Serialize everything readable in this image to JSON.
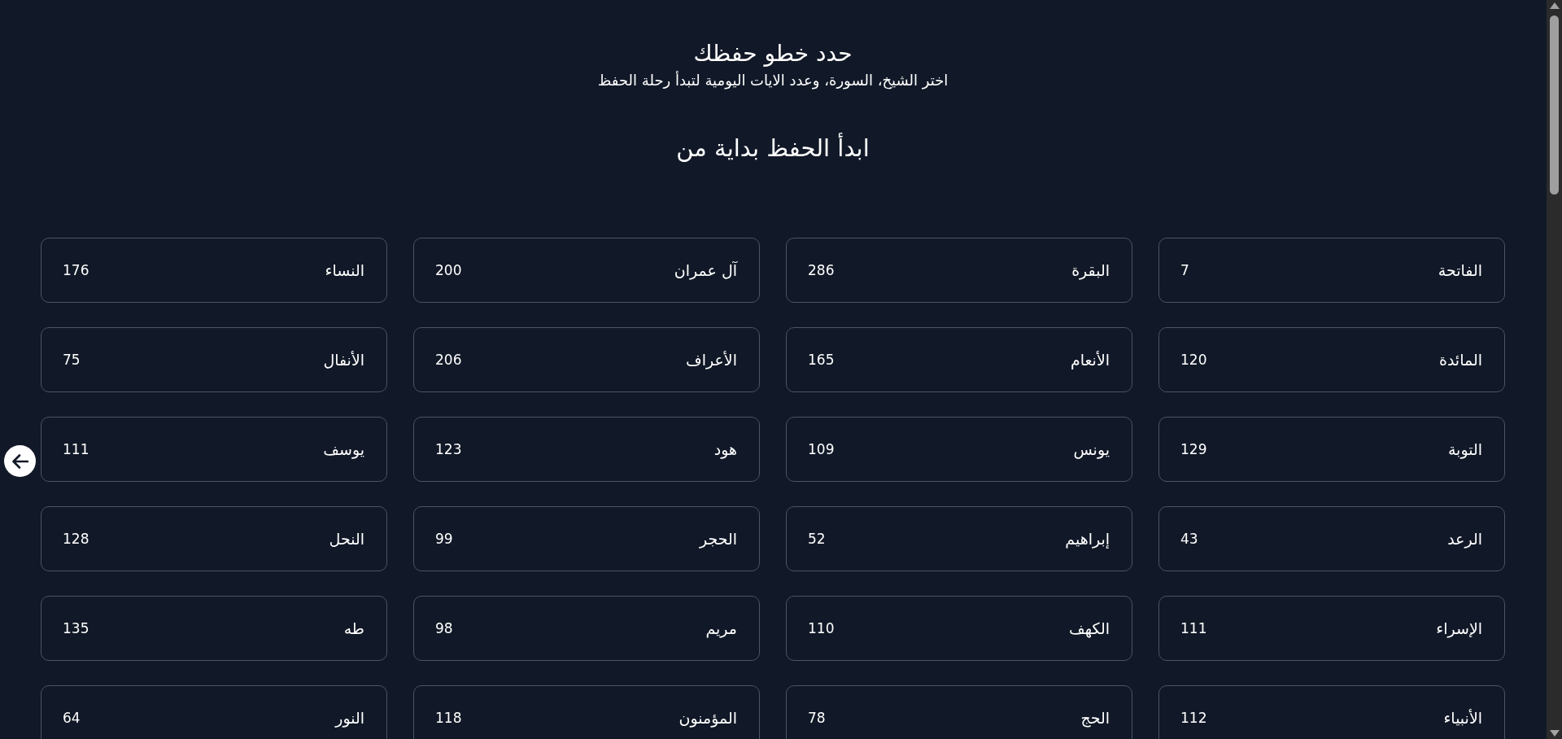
{
  "header": {
    "title": "حدد خطو حفظك",
    "subtitle": "اختر الشيخ، السورة، وعدد الايات اليومية لتبدأ رحلة الحفظ"
  },
  "section": {
    "heading": "ابدأ الحفظ بداية من"
  },
  "surahs": [
    {
      "name": "الفاتحة",
      "verses": "7"
    },
    {
      "name": "البقرة",
      "verses": "286"
    },
    {
      "name": "آل عمران",
      "verses": "200"
    },
    {
      "name": "النساء",
      "verses": "176"
    },
    {
      "name": "المائدة",
      "verses": "120"
    },
    {
      "name": "الأنعام",
      "verses": "165"
    },
    {
      "name": "الأعراف",
      "verses": "206"
    },
    {
      "name": "الأنفال",
      "verses": "75"
    },
    {
      "name": "التوبة",
      "verses": "129"
    },
    {
      "name": "يونس",
      "verses": "109"
    },
    {
      "name": "هود",
      "verses": "123"
    },
    {
      "name": "يوسف",
      "verses": "111"
    },
    {
      "name": "الرعد",
      "verses": "43"
    },
    {
      "name": "إبراهيم",
      "verses": "52"
    },
    {
      "name": "الحجر",
      "verses": "99"
    },
    {
      "name": "النحل",
      "verses": "128"
    },
    {
      "name": "الإسراء",
      "verses": "111"
    },
    {
      "name": "الكهف",
      "verses": "110"
    },
    {
      "name": "مريم",
      "verses": "98"
    },
    {
      "name": "طه",
      "verses": "135"
    },
    {
      "name": "الأنبياء",
      "verses": "112"
    },
    {
      "name": "الحج",
      "verses": "78"
    },
    {
      "name": "المؤمنون",
      "verses": "118"
    },
    {
      "name": "النور",
      "verses": "64"
    }
  ]
}
